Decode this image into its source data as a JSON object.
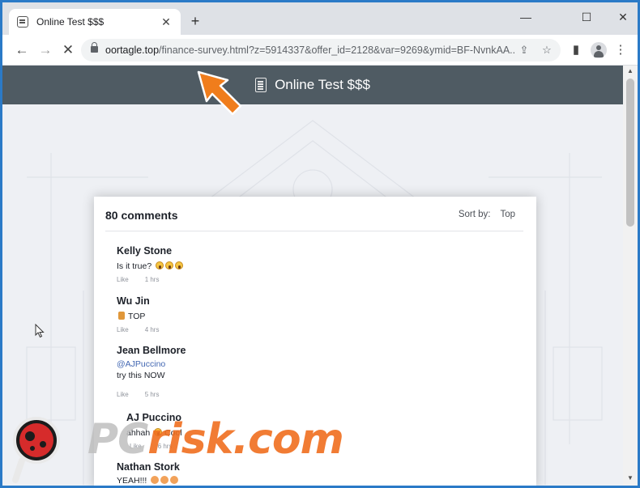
{
  "browser": {
    "tab_title": "Online Test $$$",
    "tab_close_glyph": "✕",
    "new_tab_glyph": "+",
    "window_controls": {
      "minimize": "—",
      "maximize": "☐",
      "close": "✕"
    },
    "nav": {
      "back": "←",
      "forward": "→",
      "stop": "✕"
    },
    "url_host": "oortagle.top",
    "url_rest": "/finance-survey.html?z=5914337&offer_id=2128&var=9269&ymid=BF-NvnkAA...",
    "icons": [
      "lock-icon",
      "share-icon",
      "star-icon",
      "sidebar-icon",
      "profile-icon",
      "kebab-menu-icon"
    ],
    "share_glyph": "⇪",
    "star_glyph": "☆",
    "sidebar_glyph": "▮",
    "menu_glyph": "⋮"
  },
  "site": {
    "title": "Online Test $$$",
    "header_color": "#4f5b63"
  },
  "comments": {
    "count_label": "80 comments",
    "sort_label": "Sort by:",
    "sort_value": "Top",
    "items": [
      {
        "name": "Kelly Stone",
        "text": "Is it true?",
        "emoji": [
          "screaming-face",
          "screaming-face",
          "screaming-face"
        ],
        "like": "Like",
        "time": "1 hrs"
      },
      {
        "name": "Wu Jin",
        "text": "TOP",
        "emoji": [
          "medal"
        ],
        "like": "Like",
        "time": "4 hrs"
      },
      {
        "name": "Jean Bellmore",
        "mention": "@AJPuccino",
        "text": "try this NOW",
        "like": "Like",
        "time": "5 hrs"
      },
      {
        "name": "AJ Puccino",
        "text": "ahhah",
        "text_after": "Cool",
        "emoji": [
          "face"
        ],
        "like": "Like",
        "time": "6 hrs"
      },
      {
        "name": "Nathan Stork",
        "text": "YEAH!!!",
        "emoji": [
          "heart",
          "heart",
          "heart"
        ]
      }
    ]
  },
  "watermark": {
    "prefix": "PC",
    "suffix": "risk.com"
  },
  "colors": {
    "accent_arrow": "#f07d1c",
    "link": "#4267b2",
    "window_border": "#2b7ac7"
  }
}
